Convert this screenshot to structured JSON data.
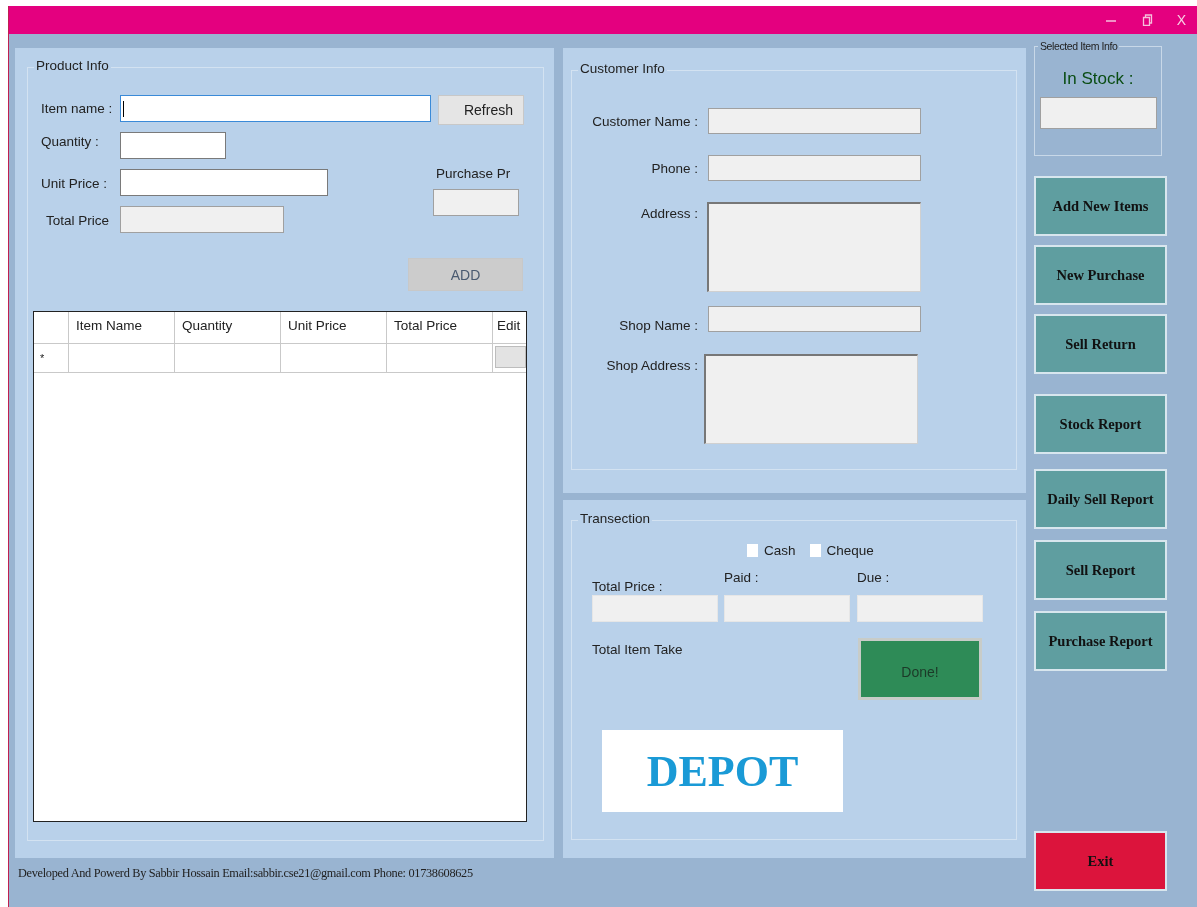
{
  "window": {
    "close": "X"
  },
  "product_info": {
    "title": "Product Info",
    "item_name": {
      "label": "Item name :"
    },
    "refresh_button": {
      "label": "Refresh",
      "disabled": false
    },
    "quantity": {
      "label": "Quantity :"
    },
    "unit_price": {
      "label": "Unit Price :"
    },
    "purchase_price": {
      "label": "Purchase Pr"
    },
    "total_price": {
      "label": "Total Price"
    },
    "add_button": {
      "label": "ADD",
      "disabled": true
    },
    "table": {
      "columns": [
        "Item Name",
        "Quantity",
        "Unit Price",
        "Total Price",
        "Edit"
      ],
      "new_row_marker": "*"
    }
  },
  "customer_info": {
    "title": "Customer Info",
    "fields": [
      {
        "label": "Customer Name :",
        "kind": "line"
      },
      {
        "label": "Phone :",
        "kind": "line"
      },
      {
        "label": "Address :",
        "kind": "area"
      },
      {
        "label": "Shop Name :",
        "kind": "line"
      },
      {
        "label": "Shop Address :",
        "kind": "area"
      }
    ]
  },
  "transection": {
    "title": "Transection",
    "payment": [
      {
        "label": "Cash",
        "checked": false
      },
      {
        "label": "Cheque",
        "checked": false
      }
    ],
    "amounts": [
      {
        "label": "Total Price :"
      },
      {
        "label": "Paid :"
      },
      {
        "label": "Due :"
      }
    ],
    "total_item_take": "Total Item Take",
    "done_button": "Done!",
    "logo": "DEPOT"
  },
  "selected_item_info": {
    "title": "Selected Item Info",
    "in_stock_label": "In Stock :"
  },
  "menu_buttons": [
    "Add New Items",
    "New Purchase",
    "Sell Return",
    "Stock Report",
    "Daily Sell Report",
    "Sell Report",
    "Purchase Report"
  ],
  "exit_button": "Exit",
  "footer": "Developed And Powerd By Sabbir Hossain  Email:sabbir.cse21@gmail.com Phone: 01738608625"
}
